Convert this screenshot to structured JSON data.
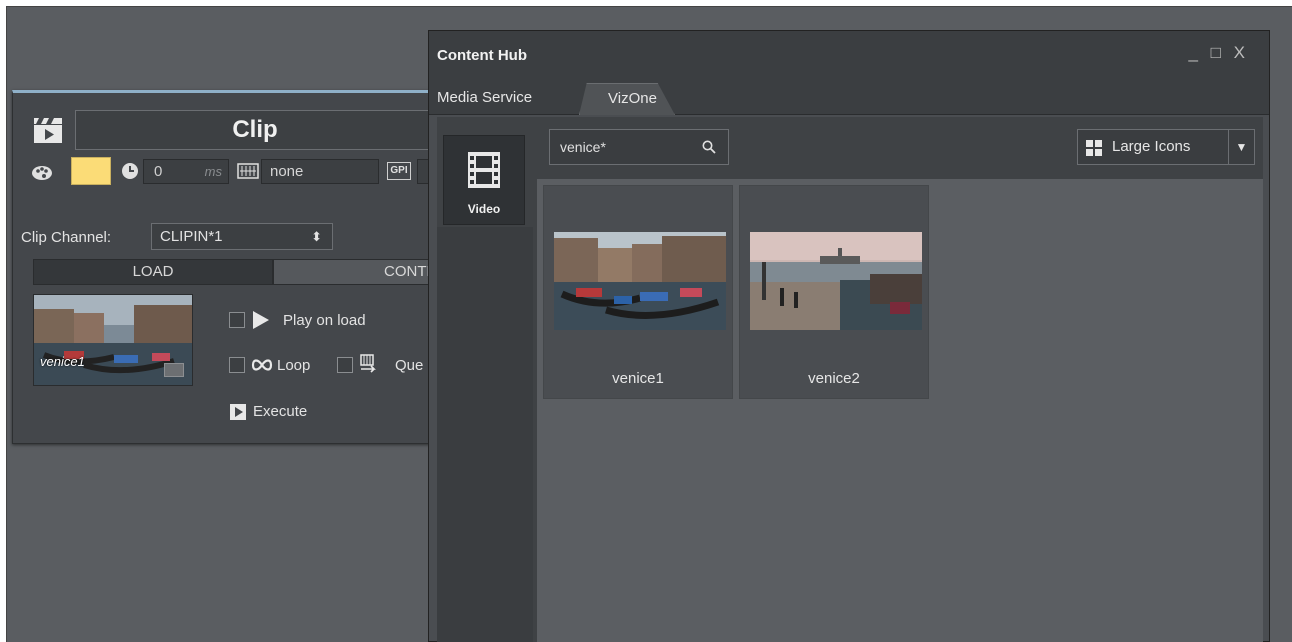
{
  "clip_panel": {
    "title": "Clip",
    "duration_value": "0",
    "duration_unit": "ms",
    "keyboard_value": "none",
    "gpi_label": "GPI",
    "color_swatch": "#fbdc77",
    "channel_label": "Clip Channel:",
    "channel_value": "CLIPIN*1",
    "tabs": {
      "load": "LOAD",
      "control": "CONTROL"
    },
    "thumbnail_label": "venice1",
    "play_on_load": "Play on load",
    "loop": "Loop",
    "queue": "Que",
    "execute": "Execute"
  },
  "content_hub": {
    "title": "Content Hub",
    "window_controls": "_ □ X",
    "tabs": [
      "Media Service",
      "VizOne"
    ],
    "active_tab": "VizOne",
    "sidebar": {
      "video_label": "Video"
    },
    "search_value": "venice*",
    "view_mode": "Large Icons",
    "results": [
      {
        "name": "venice1"
      },
      {
        "name": "venice2"
      }
    ]
  },
  "icons": [
    "clapperboard-icon",
    "palette-icon",
    "clock-icon",
    "keyboard-icon",
    "gpi-icon",
    "folder-icon",
    "play-icon",
    "loop-icon",
    "queue-icon",
    "execute-icon",
    "film-icon",
    "search-icon",
    "grid-icon",
    "dropdown-arrow-icon"
  ]
}
